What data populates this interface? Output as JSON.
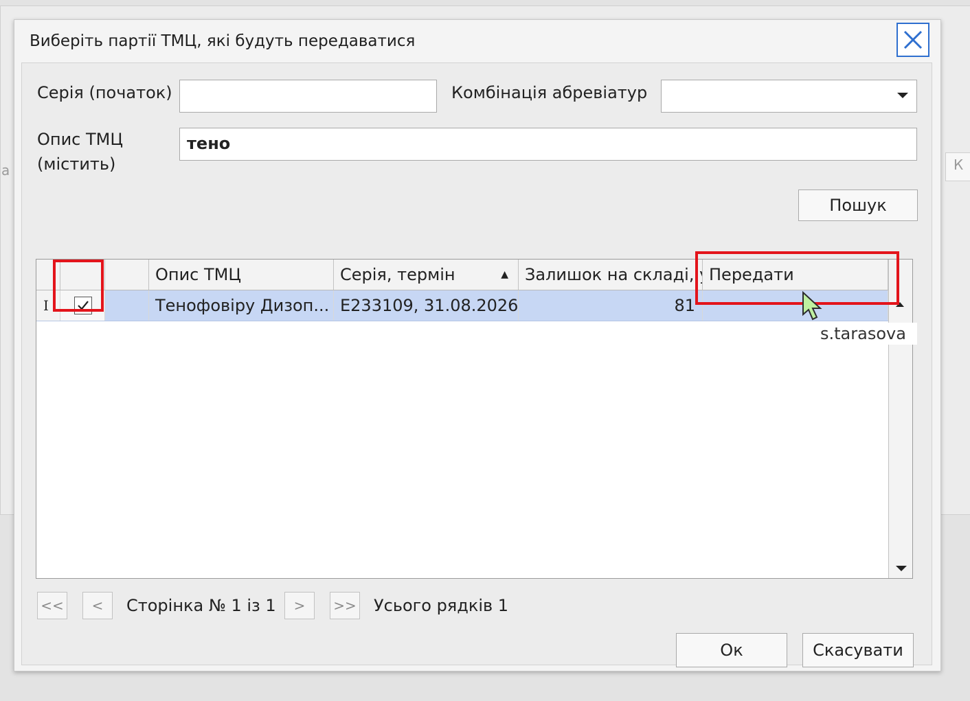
{
  "dialog": {
    "title": "Виберіть партії ТМЦ, які будуть передаватися",
    "close_icon": "close-icon"
  },
  "filters": {
    "series_label": "Серія (початок)",
    "series_value": "",
    "abbr_label": "Комбінація абревіатур",
    "abbr_value": "",
    "desc_label_line1": "Опис ТМЦ",
    "desc_label_line2": "(містить)",
    "desc_value": "тено",
    "search_button": "Пошук"
  },
  "grid": {
    "columns": [
      "",
      "",
      "",
      "Опис ТМЦ",
      "Серія, термін",
      "Залишок на складі, уп",
      "Передати"
    ],
    "sort_indicator": "▲",
    "rows": [
      {
        "indicator": "I",
        "checked": true,
        "description": "Тенофовіру Дизоп...",
        "series_term": "E233109, 31.08.2026",
        "stock": "81",
        "transfer": ""
      }
    ]
  },
  "pager": {
    "first": "<<",
    "prev": "<",
    "page_text": "Сторінка № 1 із 1",
    "next": ">",
    "last": ">>",
    "total_text": "Усього рядків 1"
  },
  "actions": {
    "ok": "Ок",
    "cancel": "Скасувати"
  },
  "cursor_tooltip": "s.tarasova",
  "colors": {
    "selected_row": "#c7d7f4",
    "highlight": "#e3141b",
    "close_border": "#2e6fcf"
  }
}
